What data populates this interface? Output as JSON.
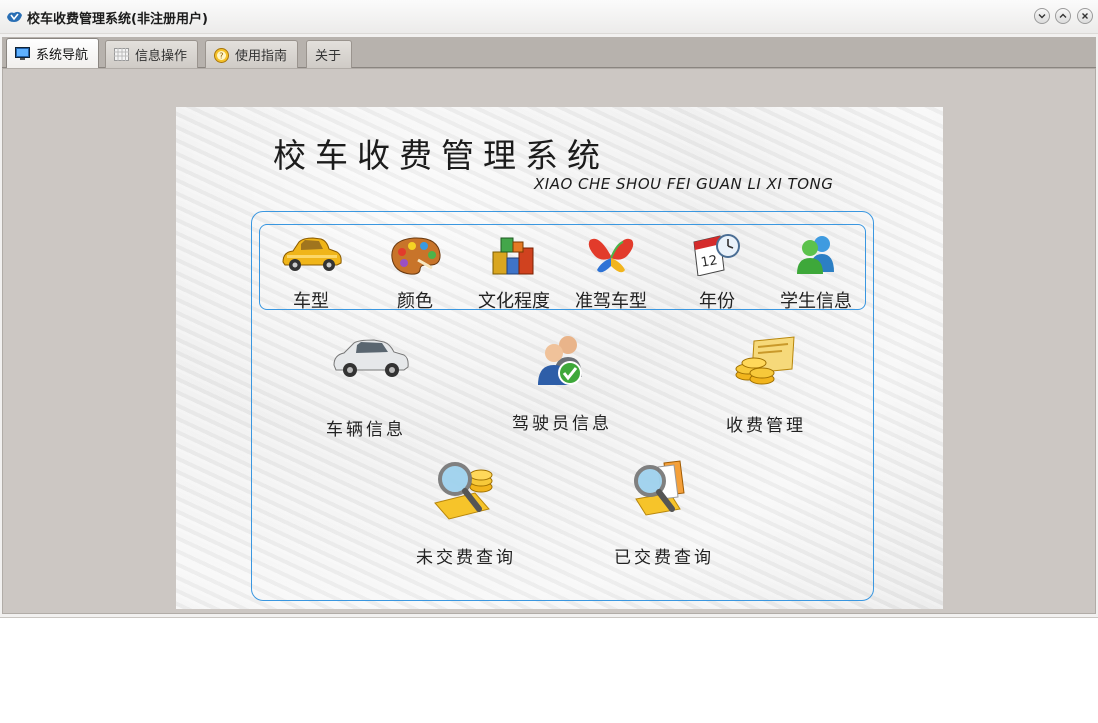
{
  "window": {
    "title": "校车收费管理系统(非注册用户)",
    "controls": [
      "minimize",
      "maximize",
      "close"
    ]
  },
  "tabs": [
    {
      "label": "系统导航",
      "icon": "monitor-icon",
      "active": true
    },
    {
      "label": "信息操作",
      "icon": "grid-icon",
      "active": false
    },
    {
      "label": "使用指南",
      "icon": "help-icon",
      "active": false
    },
    {
      "label": "关于",
      "icon": "",
      "active": false
    }
  ],
  "panel": {
    "title": "校车收费管理系统",
    "subtitle": "XIAO CHE SHOU FEI GUAN LI XI TONG"
  },
  "nav": {
    "top_row": [
      {
        "label": "车型",
        "icon": "yellow-car-icon"
      },
      {
        "label": "颜色",
        "icon": "palette-icon"
      },
      {
        "label": "文化程度",
        "icon": "building-blocks-icon"
      },
      {
        "label": "准驾车型",
        "icon": "butterfly-icon"
      },
      {
        "label": "年份",
        "icon": "calendar-clock-icon"
      },
      {
        "label": "学生信息",
        "icon": "users-icon"
      }
    ],
    "middle_row": [
      {
        "label": "车辆信息",
        "icon": "silver-car-icon"
      },
      {
        "label": "驾驶员信息",
        "icon": "drivers-check-icon"
      },
      {
        "label": "收费管理",
        "icon": "coins-card-icon"
      }
    ],
    "bottom_row": [
      {
        "label": "未交费查询",
        "icon": "search-coins-icon"
      },
      {
        "label": "已交费查询",
        "icon": "search-docs-icon"
      }
    ]
  },
  "colors": {
    "accent_border": "#3a97e0",
    "tab_strip": "#b7b2ad",
    "content_bg": "#ccc7c3"
  }
}
